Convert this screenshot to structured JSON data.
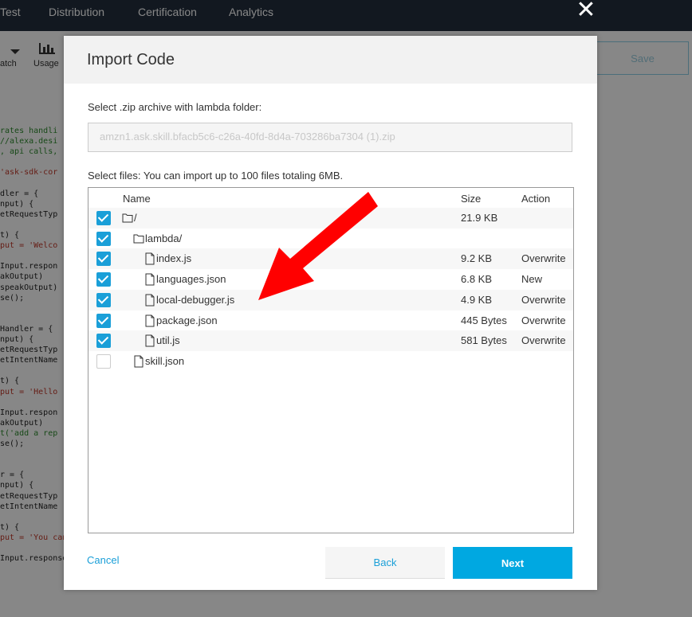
{
  "topnav": {
    "tabs": [
      "Test",
      "Distribution",
      "Certification",
      "Analytics"
    ]
  },
  "toolbar": {
    "items": [
      "atch",
      "Usage"
    ],
    "save_label": "Save"
  },
  "code_lines": [
    {
      "text": "rates handli",
      "cls": "c-green"
    },
    {
      "text": "//alexa.desi",
      "cls": "c-green"
    },
    {
      "text": ", api calls,",
      "cls": "c-green"
    },
    {
      "text": "",
      "cls": ""
    },
    {
      "text": "'ask-sdk-cor",
      "cls": "c-red"
    },
    {
      "text": "",
      "cls": ""
    },
    {
      "text": "dler = {",
      "cls": ""
    },
    {
      "text": "nput) {",
      "cls": ""
    },
    {
      "text": "etRequestTyp",
      "cls": ""
    },
    {
      "text": "",
      "cls": ""
    },
    {
      "text": "t) {",
      "cls": ""
    },
    {
      "text": "put = 'Welco",
      "cls": "c-red"
    },
    {
      "text": "",
      "cls": ""
    },
    {
      "text": "Input.respon",
      "cls": ""
    },
    {
      "text": "akOutput)",
      "cls": ""
    },
    {
      "text": "speakOutput)",
      "cls": ""
    },
    {
      "text": "se();",
      "cls": ""
    },
    {
      "text": "",
      "cls": ""
    },
    {
      "text": "",
      "cls": ""
    },
    {
      "text": "Handler = {",
      "cls": ""
    },
    {
      "text": "nput) {",
      "cls": ""
    },
    {
      "text": "etRequestTyp",
      "cls": ""
    },
    {
      "text": "etIntentName",
      "cls": ""
    },
    {
      "text": "",
      "cls": ""
    },
    {
      "text": "t) {",
      "cls": ""
    },
    {
      "text": "put = 'Hello",
      "cls": "c-red"
    },
    {
      "text": "",
      "cls": ""
    },
    {
      "text": "Input.respon",
      "cls": ""
    },
    {
      "text": "akOutput)",
      "cls": ""
    },
    {
      "text": "t('add a rep",
      "cls": "c-green"
    },
    {
      "text": "se();",
      "cls": ""
    },
    {
      "text": "",
      "cls": ""
    },
    {
      "text": "",
      "cls": ""
    },
    {
      "text": "r = {",
      "cls": ""
    },
    {
      "text": "nput) {",
      "cls": ""
    },
    {
      "text": "etRequestTyp",
      "cls": ""
    },
    {
      "text": "etIntentName",
      "cls": ""
    },
    {
      "text": "",
      "cls": ""
    },
    {
      "text": "t) {",
      "cls": ""
    },
    {
      "text": "put = 'You can say hello to me! How can I help?';",
      "cls": "c-red"
    },
    {
      "text": "",
      "cls": ""
    },
    {
      "text": "Input.responseBuilder",
      "cls": ""
    }
  ],
  "modal": {
    "title": "Import Code",
    "zip_label": "Select .zip archive with lambda folder:",
    "zip_value": "amzn1.ask.skill.bfacb5c6-c26a-40fd-8d4a-703286ba7304 (1).zip",
    "files_label": "Select files: You can import up to 100 files totaling 6MB.",
    "columns": {
      "name": "Name",
      "size": "Size",
      "action": "Action"
    },
    "files": [
      {
        "name": "/",
        "type": "folder",
        "depth": 0,
        "checked": true,
        "size": "21.9 KB",
        "action": ""
      },
      {
        "name": "lambda/",
        "type": "folder",
        "depth": 1,
        "checked": true,
        "size": "",
        "action": ""
      },
      {
        "name": "index.js",
        "type": "file",
        "depth": 2,
        "checked": true,
        "size": "9.2 KB",
        "action": "Overwrite"
      },
      {
        "name": "languages.json",
        "type": "file",
        "depth": 2,
        "checked": true,
        "size": "6.8 KB",
        "action": "New"
      },
      {
        "name": "local-debugger.js",
        "type": "file",
        "depth": 2,
        "checked": true,
        "size": "4.9 KB",
        "action": "Overwrite"
      },
      {
        "name": "package.json",
        "type": "file",
        "depth": 2,
        "checked": true,
        "size": "445 Bytes",
        "action": "Overwrite"
      },
      {
        "name": "util.js",
        "type": "file",
        "depth": 2,
        "checked": true,
        "size": "581 Bytes",
        "action": "Overwrite"
      },
      {
        "name": "skill.json",
        "type": "file",
        "depth": 1,
        "checked": false,
        "size": "",
        "action": ""
      }
    ],
    "cancel_label": "Cancel",
    "back_label": "Back",
    "next_label": "Next"
  },
  "colors": {
    "accent": "#00a8e1",
    "checkbox": "#1a9fd8",
    "nav_bg": "#232f3e",
    "arrow": "#ff0000"
  },
  "icons": [
    "close-icon",
    "chevron-down-icon",
    "bar-chart-icon",
    "folder-icon",
    "file-icon",
    "arrow-annotation"
  ]
}
